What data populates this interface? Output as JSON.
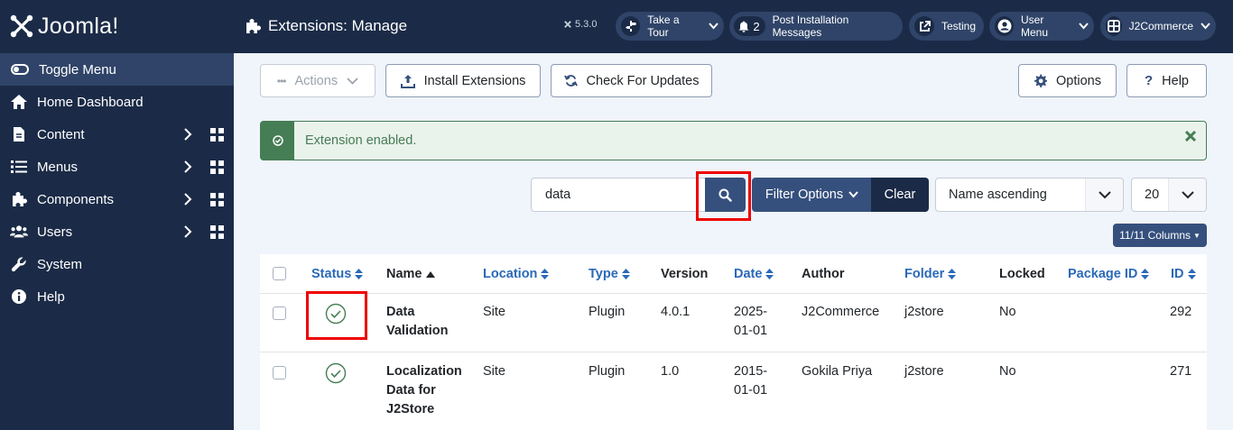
{
  "sidebar": {
    "logo_text": "Joomla!",
    "toggle_label": "Toggle Menu",
    "items": [
      {
        "label": "Home Dashboard",
        "icon": "home-icon"
      },
      {
        "label": "Content",
        "icon": "file-icon"
      },
      {
        "label": "Menus",
        "icon": "list-icon"
      },
      {
        "label": "Components",
        "icon": "puzzle-icon"
      },
      {
        "label": "Users",
        "icon": "users-icon"
      },
      {
        "label": "System",
        "icon": "wrench-icon"
      },
      {
        "label": "Help",
        "icon": "info-icon"
      }
    ]
  },
  "header": {
    "title": "Extensions: Manage",
    "version": "5.3.0",
    "take_tour": "Take a Tour",
    "post_install_count": "2",
    "post_install": "Post Installation Messages",
    "site_name": "Testing",
    "user_menu": "User Menu",
    "j2commerce": "J2Commerce"
  },
  "toolbar": {
    "actions": "Actions",
    "install": "Install Extensions",
    "check_updates": "Check For Updates",
    "options": "Options",
    "help": "Help"
  },
  "alert": {
    "message": "Extension enabled."
  },
  "filters": {
    "search_value": "data",
    "filter_options": "Filter Options",
    "clear": "Clear",
    "ordering": "Name ascending",
    "limit": "20",
    "columns": "11/11 Columns"
  },
  "table": {
    "headers": {
      "status": "Status",
      "name": "Name",
      "location": "Location",
      "type": "Type",
      "version": "Version",
      "date": "Date",
      "author": "Author",
      "folder": "Folder",
      "locked": "Locked",
      "package_id": "Package ID",
      "id": "ID"
    },
    "rows": [
      {
        "name_1": "Data",
        "name_2": "Validation",
        "name_3": "",
        "location": "Site",
        "type": "Plugin",
        "version": "4.0.1",
        "date_1": "2025-",
        "date_2": "01-01",
        "author": "J2Commerce",
        "folder": "j2store",
        "locked": "No",
        "package_id": "",
        "id": "292"
      },
      {
        "name_1": "Localization",
        "name_2": "Data for",
        "name_3": "J2Store",
        "location": "Site",
        "type": "Plugin",
        "version": "1.0",
        "date_1": "2015-",
        "date_2": "01-01",
        "author": "Gokila Priya",
        "folder": "j2store",
        "locked": "No",
        "package_id": "",
        "id": "271"
      }
    ]
  },
  "colors": {
    "sidebar_bg": "#1b2b47",
    "accent": "#36507d",
    "success": "#457d54",
    "link": "#2a69b8",
    "highlight": "#ee0000"
  }
}
